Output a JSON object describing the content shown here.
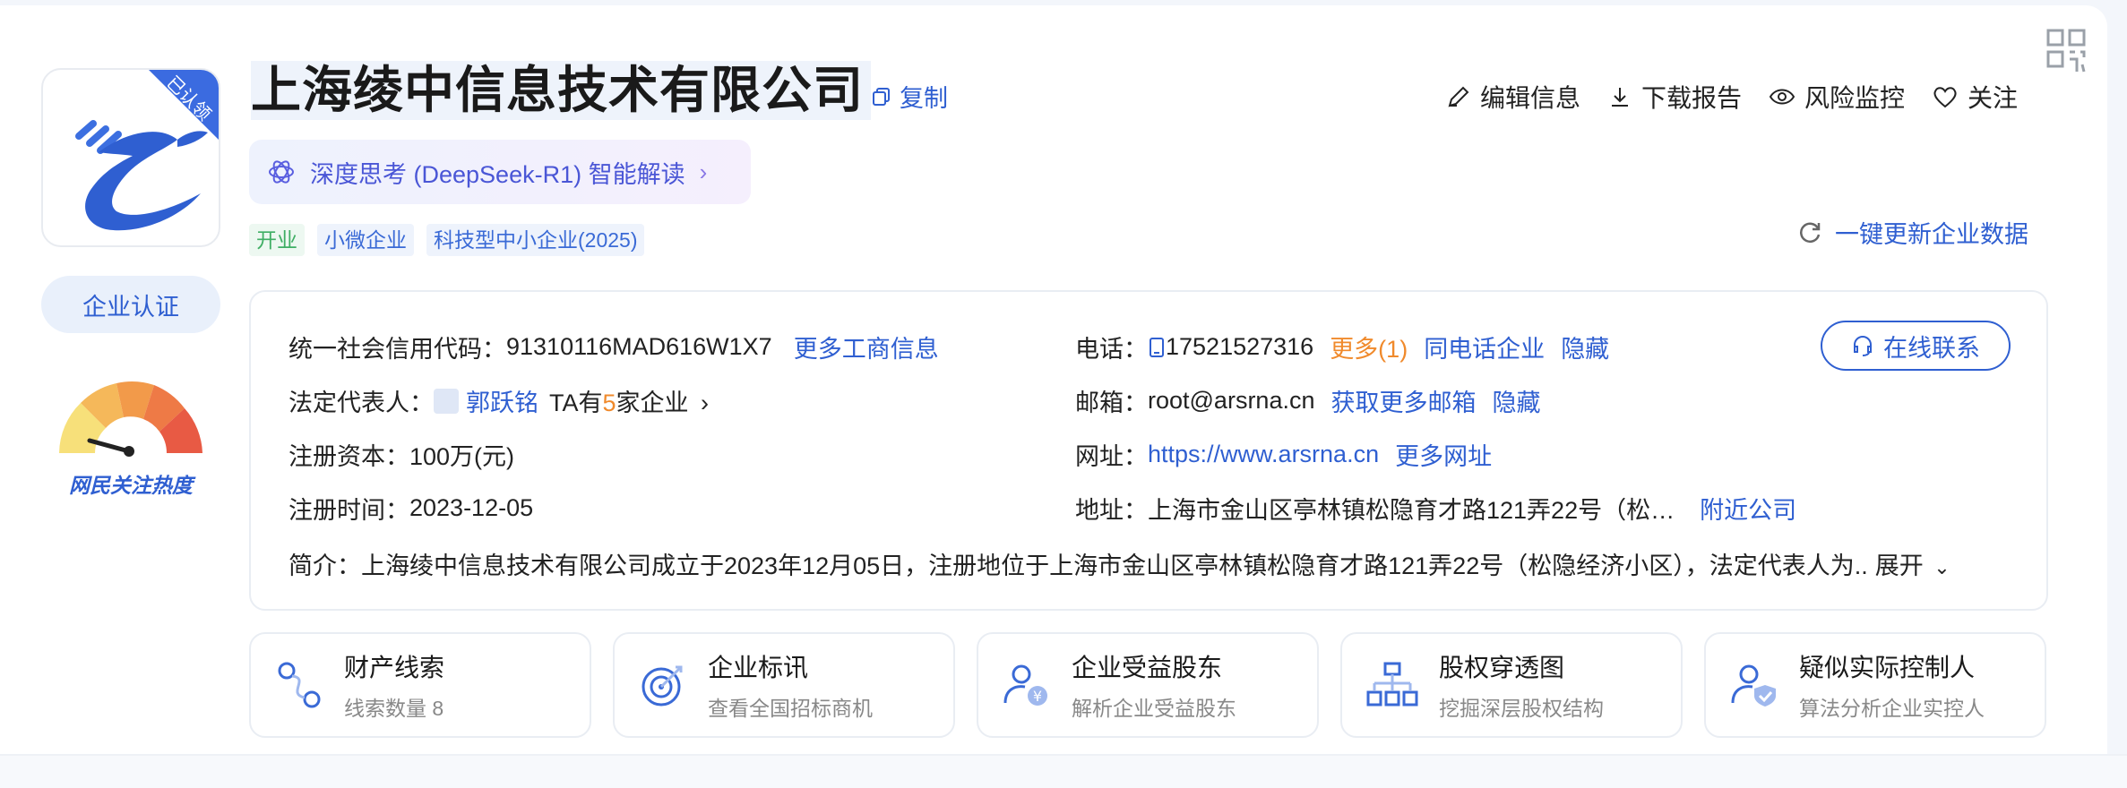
{
  "company": {
    "name": "上海绫中信息技术有限公司",
    "copy_label": "复制",
    "logo_badge": "已认领",
    "cert_label": "企业认证",
    "heat_label": "网民关注热度"
  },
  "ai_pill": {
    "label": "深度思考 (DeepSeek-R1) 智能解读"
  },
  "tags": [
    "开业",
    "小微企业",
    "科技型中小企业(2025)"
  ],
  "actions": [
    {
      "label": "编辑信息",
      "icon": "edit-icon"
    },
    {
      "label": "下载报告",
      "icon": "download-icon"
    },
    {
      "label": "风险监控",
      "icon": "eye-icon"
    },
    {
      "label": "关注",
      "icon": "heart-icon"
    }
  ],
  "refresh_label": "一键更新企业数据",
  "info": {
    "credit_code_label": "统一社会信用代码：",
    "credit_code": "91310116MAD616W1X7",
    "more_business": "更多工商信息",
    "legal_rep_label": "法定代表人：",
    "legal_rep": "郭跃铭",
    "ta_prefix": "TA有",
    "ta_count": "5",
    "ta_suffix": "家企业",
    "capital_label": "注册资本：",
    "capital": "100万(元)",
    "reg_time_label": "注册时间：",
    "reg_time": "2023-12-05",
    "phone_label": "电话：",
    "phone": "17521527316",
    "phone_more": "更多(1)",
    "same_phone": "同电话企业",
    "hide1": "隐藏",
    "email_label": "邮箱：",
    "email": "root@arsrna.cn",
    "more_email": "获取更多邮箱",
    "hide2": "隐藏",
    "website_label": "网址：",
    "website": "https://www.arsrna.cn",
    "more_website": "更多网址",
    "address_label": "地址：",
    "address": "上海市金山区亭林镇松隐育才路121弄22号（松…",
    "nearby": "附近公司",
    "intro_label": "简介：",
    "intro": "上海绫中信息技术有限公司成立于2023年12月05日，注册地位于上海市金山区亭林镇松隐育才路121弄22号（松隐经济小区），法定代表人为..",
    "expand": "展开",
    "online_contact": "在线联系"
  },
  "features": [
    {
      "title": "财产线索",
      "subtitle": "线索数量 8",
      "icon": "asset-clue-icon"
    },
    {
      "title": "企业标讯",
      "subtitle": "查看全国招标商机",
      "icon": "target-icon"
    },
    {
      "title": "企业受益股东",
      "subtitle": "解析企业受益股东",
      "icon": "beneficiary-icon"
    },
    {
      "title": "股权穿透图",
      "subtitle": "挖掘深层股权结构",
      "icon": "equity-tree-icon"
    },
    {
      "title": "疑似实际控制人",
      "subtitle": "算法分析企业实控人",
      "icon": "controller-icon"
    }
  ],
  "colors": {
    "accent": "#2f5fd1",
    "orange": "#f08a2c",
    "green": "#3fae64"
  }
}
